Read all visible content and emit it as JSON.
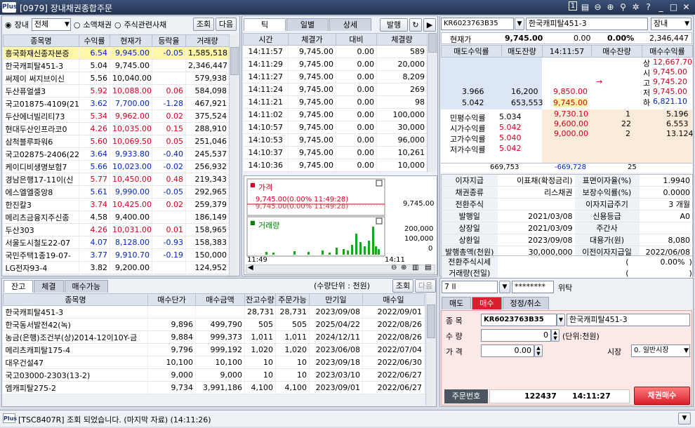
{
  "window": {
    "logo": "Plus",
    "title": "[0979] 장내채권종합주문",
    "page_no": "1"
  },
  "left": {
    "market_radio": "장내",
    "market_select": "전체",
    "radio2": "소액채권",
    "radio3": "주식관련사채",
    "btn_query": "조회",
    "btn_next": "다음",
    "headers": [
      "종목명",
      "수익률",
      "현재가",
      "등락율",
      "거래량"
    ],
    "rows": [
      [
        "흥국화재신종자본증",
        {
          "v": "6.54",
          "c": "blue"
        },
        {
          "v": "9,945.00",
          "c": "blue"
        },
        {
          "v": "-0.05",
          "c": "blue"
        },
        "1,585,518"
      ],
      [
        "한국캐피탈451-3",
        {
          "v": "5.04",
          "c": ""
        },
        {
          "v": "9,745.00",
          "c": ""
        },
        {
          "v": "",
          "c": ""
        },
        "2,346,447"
      ],
      [
        "써제이 써지브이신",
        {
          "v": "5.56",
          "c": ""
        },
        {
          "v": "10,040.00",
          "c": ""
        },
        {
          "v": "",
          "c": ""
        },
        "579,938"
      ],
      [
        "두산퓨얼셀3",
        {
          "v": "5.92",
          "c": "red"
        },
        {
          "v": "10,088.00",
          "c": "red"
        },
        {
          "v": "0.06",
          "c": "red"
        },
        "584,098"
      ],
      [
        "국고01875-4109(21",
        {
          "v": "3.62",
          "c": "blue"
        },
        {
          "v": "7,700.00",
          "c": "blue"
        },
        {
          "v": "-1.28",
          "c": "blue"
        },
        "467,921"
      ],
      [
        "두산에너빌리티73",
        {
          "v": "5.34",
          "c": "red"
        },
        {
          "v": "9,962.00",
          "c": "red"
        },
        {
          "v": "0.02",
          "c": "red"
        },
        "375,524"
      ],
      [
        "현대두산인프라코0",
        {
          "v": "4.26",
          "c": "red"
        },
        {
          "v": "10,035.00",
          "c": "red"
        },
        {
          "v": "0.15",
          "c": "red"
        },
        "288,910"
      ],
      [
        "삼척블루파워6",
        {
          "v": "5.60",
          "c": "red"
        },
        {
          "v": "10,069.50",
          "c": "red"
        },
        {
          "v": "0.05",
          "c": "red"
        },
        "251,046"
      ],
      [
        "국고02875-2406(22",
        {
          "v": "3.64",
          "c": "blue"
        },
        {
          "v": "9,933.80",
          "c": "blue"
        },
        {
          "v": "-0.40",
          "c": "blue"
        },
        "245,537"
      ],
      [
        "케이디비생명보험7",
        {
          "v": "5.66",
          "c": "blue"
        },
        {
          "v": "10,023.00",
          "c": "blue"
        },
        {
          "v": "-0.02",
          "c": "blue"
        },
        "256,932"
      ],
      [
        "경남은행17-11이(신",
        {
          "v": "5.77",
          "c": "red"
        },
        {
          "v": "10,450.00",
          "c": "red"
        },
        {
          "v": "0.48",
          "c": "red"
        },
        "219,343"
      ],
      [
        "에스엘엘중앙8",
        {
          "v": "5.61",
          "c": "blue"
        },
        {
          "v": "9,990.00",
          "c": "blue"
        },
        {
          "v": "-0.05",
          "c": "blue"
        },
        "292,965"
      ],
      [
        "한진칼3",
        {
          "v": "3.74",
          "c": "red"
        },
        {
          "v": "10,425.00",
          "c": "red"
        },
        {
          "v": "0.02",
          "c": "red"
        },
        "259,379"
      ],
      [
        "메리츠금융지주신종",
        {
          "v": "4.58",
          "c": ""
        },
        {
          "v": "9,400.00",
          "c": ""
        },
        {
          "v": "",
          "c": ""
        },
        "186,149"
      ],
      [
        "두산303",
        {
          "v": "4.26",
          "c": "red"
        },
        {
          "v": "10,031.00",
          "c": "red"
        },
        {
          "v": "0.01",
          "c": "red"
        },
        "158,965"
      ],
      [
        "서울도시철도22-07",
        {
          "v": "4.07",
          "c": "blue"
        },
        {
          "v": "8,128.00",
          "c": "blue"
        },
        {
          "v": "-0.93",
          "c": "blue"
        },
        "158,383"
      ],
      [
        "국민주택1종19-07-",
        {
          "v": "3.77",
          "c": "blue"
        },
        {
          "v": "9,910.70",
          "c": "blue"
        },
        {
          "v": "-0.19",
          "c": "blue"
        },
        "150,000"
      ],
      [
        "LG전자93-4",
        {
          "v": "3.82",
          "c": ""
        },
        {
          "v": "9,200.00",
          "c": ""
        },
        {
          "v": "",
          "c": ""
        },
        "124,952"
      ]
    ]
  },
  "middle": {
    "tabs": [
      "틱",
      "일별",
      "상세"
    ],
    "btn_issue": "발행",
    "headers": [
      "시간",
      "체결가",
      "대비",
      "체결량"
    ],
    "rows": [
      [
        "14:11:57",
        "9,745.00",
        "0.00",
        "589"
      ],
      [
        "14:11:29",
        "9,745.00",
        "0.00",
        "20,000"
      ],
      [
        "14:11:27",
        "9,745.00",
        "0.00",
        "8,209"
      ],
      [
        "14:11:24",
        "9,745.00",
        "0.00",
        "269"
      ],
      [
        "14:11:21",
        "9,745.00",
        "0.00",
        "98"
      ],
      [
        "14:11:02",
        "9,745.00",
        "0.00",
        "100,000"
      ],
      [
        "14:10:57",
        "9,745.00",
        "0.00",
        "30,000"
      ],
      [
        "14:10:53",
        "9,745.00",
        "0.00",
        "96,000"
      ],
      [
        "14:10:37",
        "9,745.00",
        "0.00",
        "10,261"
      ],
      [
        "14:10:36",
        "9,745.00",
        "0.00",
        "10,000"
      ]
    ],
    "chart": {
      "price_label": "가격",
      "volume_label": "거래량",
      "line1": "9,745.00(0.00% 11:49:28)",
      "line2": "9,745.00(0.00% 11:49:28)",
      "price_axis": "9,745.00",
      "vol_axis": [
        "200,000",
        "100,000",
        "0"
      ],
      "time_start": "11:49",
      "time_end": "14:11"
    }
  },
  "right": {
    "code": "KR6023763B35",
    "name": "한국캐피탈451-3",
    "market": "장내",
    "summary": {
      "label": "현재가",
      "price": "9,745.00",
      "change": "0.00",
      "rate": "0.00%",
      "volume": "2,346,447"
    },
    "ob_headers": [
      "매도수익률",
      "매도잔량",
      "14:11:57",
      "매수잔량",
      "매수수익률"
    ],
    "ask_rows": [
      [
        "3.966",
        "16,200",
        "9,850.00"
      ],
      [
        "5.042",
        "653,553",
        "9,745.00"
      ]
    ],
    "bid_rows": [
      [
        "9,730.10",
        "1",
        "5.196"
      ],
      [
        "9,600.00",
        "22",
        "6.553"
      ],
      [
        "9,000.00",
        "2",
        "13.124"
      ]
    ],
    "side_labels": [
      "상",
      "시",
      "고",
      "저",
      "하"
    ],
    "side_values": [
      "12,667.70",
      "9,745.00",
      "9,745.20",
      "9,745.00",
      "6,821.10"
    ],
    "yields": [
      [
        "민평수익률",
        "5.034"
      ],
      [
        "시가수익률",
        "5.042"
      ],
      [
        "고가수익률",
        "5.040"
      ],
      [
        "저가수익률",
        "5.042"
      ]
    ],
    "totals": [
      "669,753",
      "-669,728",
      "25"
    ],
    "info": [
      [
        "이자지급",
        "이표채(확정금리)",
        "표면이자율(%)",
        "1.9940"
      ],
      [
        "채권종류",
        "리스채권",
        "보장수익률(%)",
        "0.0000"
      ],
      [
        "전환주식",
        "",
        "이자지급주기",
        "3 개월"
      ],
      [
        "발행일",
        "2021/03/08",
        "신용등급",
        "A0"
      ],
      [
        "상장일",
        "2021/03/09",
        "주간사",
        ""
      ],
      [
        "상환일",
        "2023/09/08",
        "대용가(원)",
        "8,080"
      ],
      [
        "발행총액(천원)",
        "30,000,000",
        "이전이자지급일",
        "2022/06/08"
      ]
    ],
    "conv": [
      [
        "전환주식시세",
        "(",
        "0.00%",
        ")"
      ],
      [
        "거래량(전일)",
        "(",
        "",
        ")"
      ]
    ],
    "account": "7 ll",
    "password": "********",
    "proxy": "위탁",
    "order_tabs": [
      "매도",
      "매수",
      "정정/취소"
    ],
    "order": {
      "code_label": "종  목",
      "code": "KR6023763B35",
      "name": "한국캐피탈451-3",
      "qty_label": "수  량",
      "qty": "0",
      "qty_unit": "(단위:천원)",
      "price_label": "가  격",
      "price": "0.00",
      "market_label": "시장",
      "market": "0. 일반시장"
    },
    "order_no_label": "주문번호",
    "order_no": "122437",
    "order_time": "14:11:27",
    "buy_button": "채권매수"
  },
  "bottom": {
    "tabs": [
      "잔고",
      "체결",
      "매수가능"
    ],
    "unit": "(수량단위 : 천원)",
    "btn_query": "조회",
    "btn_next": "다음",
    "headers": [
      "종목명",
      "매수단가",
      "매수금액",
      "잔고수량",
      "주문가능",
      "만기일",
      "매수일"
    ],
    "rows": [
      [
        "한국캐피탈451-3",
        "",
        "",
        "28,731",
        "28,731",
        "2023/09/08",
        "2022/09/01"
      ],
      [
        "한국동서발전42(녹)",
        "9,896",
        "499,790",
        "505",
        "505",
        "2025/04/22",
        "2022/08/26"
      ],
      [
        "농금(은행)조건부(상)2014-12이10Y-금",
        "9,884",
        "999,373",
        "1,011",
        "1,011",
        "2024/12/11",
        "2022/08/26"
      ],
      [
        "메리츠캐피탈175-4",
        "9,796",
        "999,192",
        "1,020",
        "1,020",
        "2023/06/08",
        "2022/07/04"
      ],
      [
        "대우건설47",
        "10,100",
        "10,100",
        "10",
        "10",
        "2023/09/18",
        "2022/06/30"
      ],
      [
        "국고03000-2303(13-2)",
        "9,000",
        "9,000",
        "10",
        "10",
        "2023/03/10",
        "2022/06/27"
      ],
      [
        "엠캐피탈275-2",
        "9,734",
        "3,991,186",
        "4,100",
        "4,100",
        "2023/09/01",
        "2022/06/27"
      ]
    ]
  },
  "status": {
    "text": "[TSC8407R] 조회 되었습니다. (마지막 자료) (14:11:26)"
  }
}
